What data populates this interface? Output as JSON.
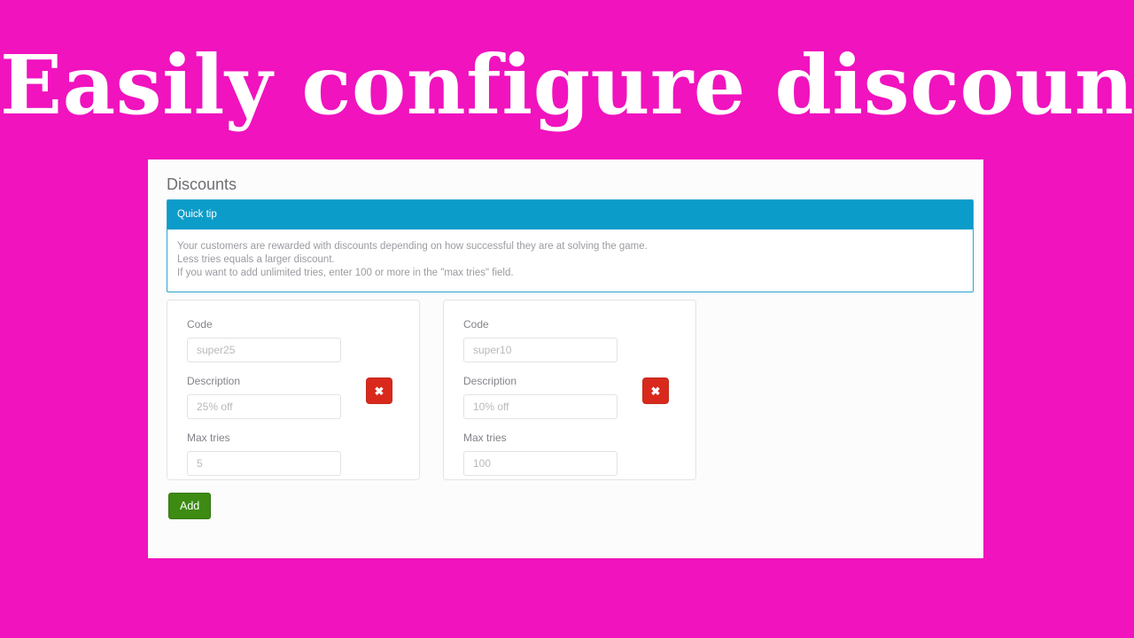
{
  "hero": {
    "title": "Easily configure discounts"
  },
  "colors": {
    "background_magenta": "#f013be",
    "panel_white": "#fdfcfd",
    "tip_header_blue": "#0c9cc9",
    "tip_border_blue": "#29a3d0",
    "delete_red": "#d9291c",
    "add_green": "#3d8b12",
    "label_gray": "#83838b",
    "placeholder_gray": "#b9b9be"
  },
  "panel": {
    "title": "Discounts",
    "tip": {
      "header": "Quick tip",
      "lines": [
        "Your customers are rewarded with discounts depending on how successful they are at solving the game.",
        "Less tries equals a larger discount.",
        "If you want to add unlimited tries, enter 100 or more in the \"max tries\" field."
      ]
    },
    "field_labels": {
      "code": "Code",
      "description": "Description",
      "max_tries": "Max tries"
    },
    "discounts": [
      {
        "code": "super25",
        "description": "25% off",
        "max_tries": "5",
        "delete_label": "✖"
      },
      {
        "code": "super10",
        "description": "10% off",
        "max_tries": "100",
        "delete_label": "✖"
      }
    ],
    "add_label": "Add"
  }
}
